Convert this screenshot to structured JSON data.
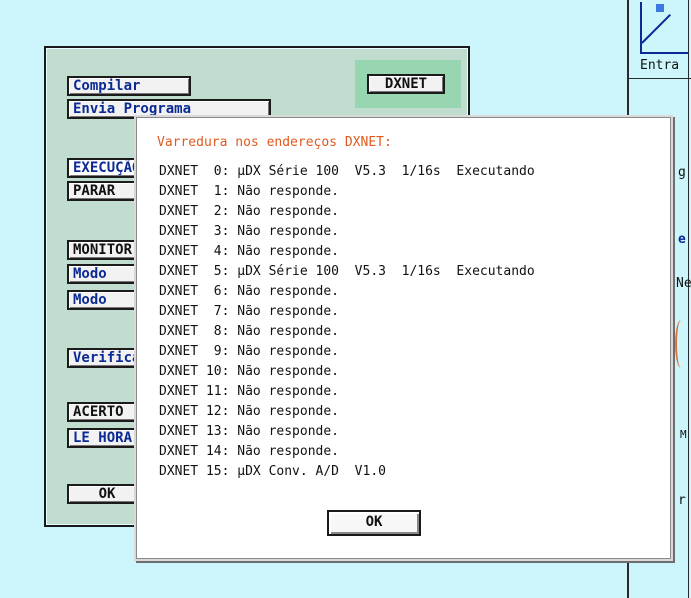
{
  "background": {
    "right_labels": [
      "Entra",
      "g",
      "e",
      "Ne",
      "M",
      "r"
    ]
  },
  "panel": {
    "buttons": {
      "compilar": "Compilar",
      "dxnet": "DXNET",
      "envia": "Envia Programa",
      "execucao": "EXECUÇÃO",
      "parar": "PARAR",
      "monitor": "MONITOR",
      "modo1": "Modo",
      "modo2": "Modo",
      "verificar": "Verificar",
      "acerto": "ACERTO",
      "le_hora": "LE HORA",
      "ok": "OK"
    }
  },
  "dialog": {
    "title": "Varredura nos endereços DXNET:",
    "lines": [
      "DXNET  0: µDX Série 100  V5.3  1/16s  Executando",
      "DXNET  1: Não responde.",
      "DXNET  2: Não responde.",
      "DXNET  3: Não responde.",
      "DXNET  4: Não responde.",
      "DXNET  5: µDX Série 100  V5.3  1/16s  Executando",
      "DXNET  6: Não responde.",
      "DXNET  7: Não responde.",
      "DXNET  8: Não responde.",
      "DXNET  9: Não responde.",
      "DXNET 10: Não responde.",
      "DXNET 11: Não responde.",
      "DXNET 12: Não responde.",
      "DXNET 13: Não responde.",
      "DXNET 14: Não responde.",
      "DXNET 15: µDX Conv. A/D  V1.0"
    ],
    "ok_label": "OK"
  },
  "colors": {
    "background": "#ccf6fb",
    "panel": "#c0ddd0",
    "dxnet_zone": "#97d6b1",
    "title_orange": "#e05a1e",
    "button_text_blue": "#0b2a95"
  }
}
